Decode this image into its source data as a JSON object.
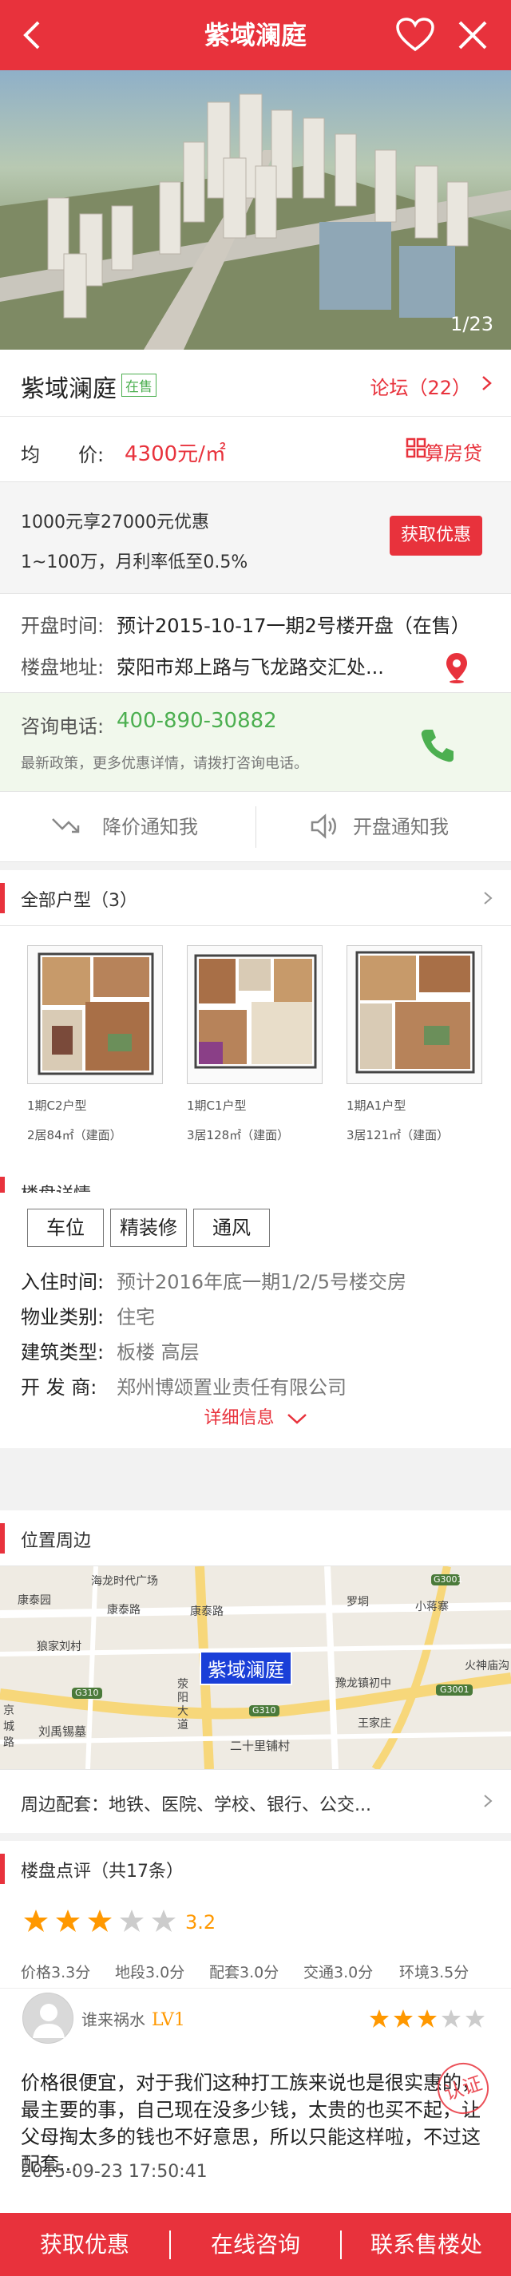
{
  "header": {
    "title": "紫域澜庭"
  },
  "hero": {
    "pager": "1/23"
  },
  "property": {
    "name": "紫域澜庭",
    "status_tag": "在售",
    "forum_link": "论坛（22）"
  },
  "price": {
    "label": "均　　价:",
    "value": "4300元/㎡",
    "calc_label": "算房贷"
  },
  "promo": {
    "line1": "1000元享27000元优惠",
    "line2": "1~100万，月利率低至0.5%",
    "button": "获取优惠"
  },
  "info": {
    "open_label": "开盘时间:",
    "open_value": "预计2015-10-17一期2号楼开盘（在售）",
    "address_label": "楼盘地址:",
    "address_value": "荥阳市郑上路与飞龙路交汇处..."
  },
  "consult": {
    "label": "咨询电话:",
    "phone": "400-890-30882",
    "sub": "最新政策，更多优惠详情，请拨打咨询电话。"
  },
  "notify": {
    "price_drop": "降价通知我",
    "opening": "开盘通知我"
  },
  "floorplans": {
    "title": "全部户型（3）",
    "items": [
      {
        "name": "1期C2户型",
        "desc": "2居84㎡（建面）"
      },
      {
        "name": "1期C1户型",
        "desc": "3居128㎡（建面）"
      },
      {
        "name": "1期A1户型",
        "desc": "3居121㎡（建面）"
      }
    ]
  },
  "details": {
    "title": "楼盘详情",
    "tags": [
      "车位",
      "精装修",
      "通风"
    ],
    "rows": [
      {
        "label": "入住时间:",
        "value": "预计2016年底一期1/2/5号楼交房"
      },
      {
        "label": "物业类别:",
        "value": "住宅"
      },
      {
        "label": "建筑类型:",
        "value": "板楼 高层"
      },
      {
        "label": "开 发 商:",
        "value": "郑州博颂置业责任有限公司"
      }
    ],
    "more": "详细信息"
  },
  "location": {
    "title": "位置周边",
    "map_labels": {
      "marker": "紫域澜庭",
      "haifu": "海龙时代广场",
      "kangtai_w": "康泰园",
      "kangtai_rd1": "康泰路",
      "kangtai_rd2": "康泰路",
      "luoyin": "罗垌",
      "xiaozhai": "小蒋寨",
      "langjun": "狼家刘村",
      "g310a": "G310",
      "g310b": "G310",
      "g3001a": "G3001",
      "g3001b": "G3001",
      "yulong": "豫龙镇初中",
      "wangjia": "王家庄",
      "huoshen": "火神庙沟",
      "liuxiang": "刘禹锡墓",
      "jing": "京城路",
      "ershi": "二十里铺村",
      "xingyang": "荥阳大道"
    },
    "nearby": "周边配套：地铁、医院、学校、银行、公交..."
  },
  "reviews": {
    "title": "楼盘点评（共17条）",
    "rating": "3.2",
    "scores": [
      {
        "label": "价格3.3分"
      },
      {
        "label": "地段3.0分"
      },
      {
        "label": "配套3.0分"
      },
      {
        "label": "交通3.0分"
      },
      {
        "label": "环境3.5分"
      }
    ],
    "item": {
      "user": "谁来祸水",
      "level": "LV1",
      "stars": 3,
      "text": "价格很便宜，对于我们这种打工族来说也是很实惠的，最主要的事，自己现在没多少钱，太贵的也买不起，让父母掏太多的钱也不好意思，所以只能这样啦，不过这配套...",
      "time": "2015-09-23 17:50:41",
      "stamp": "认证"
    }
  },
  "bottom_bar": {
    "b1": "获取优惠",
    "b2": "在线咨询",
    "b3": "联系售楼处"
  },
  "colors": {
    "accent": "#e8323c",
    "green": "#4caf50",
    "star": "#ff9800"
  }
}
